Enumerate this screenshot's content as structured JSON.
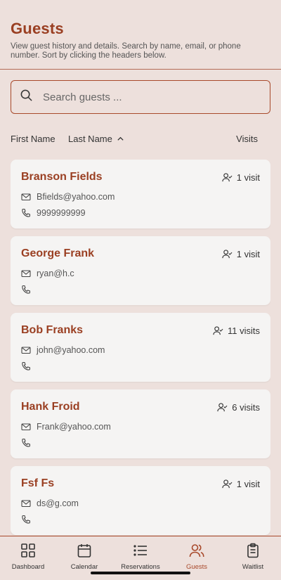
{
  "header": {
    "title": "Guests",
    "subtitle": "View guest history and details. Search by name, email, or phone number. Sort by clicking the headers below."
  },
  "search": {
    "placeholder": "Search guests ..."
  },
  "columns": {
    "first": "First Name",
    "last": "Last Name",
    "visits": "Visits"
  },
  "guests": [
    {
      "name": "Branson Fields",
      "visits": "1 visit",
      "email": "Bfields@yahoo.com",
      "phone": "9999999999"
    },
    {
      "name": "George Frank",
      "visits": "1 visit",
      "email": "ryan@h.c",
      "phone": ""
    },
    {
      "name": "Bob Franks",
      "visits": "11 visits",
      "email": "john@yahoo.com",
      "phone": ""
    },
    {
      "name": "Hank Froid",
      "visits": "6 visits",
      "email": "Frank@yahoo.com",
      "phone": ""
    },
    {
      "name": "Fsf Fs",
      "visits": "1 visit",
      "email": "ds@g.com",
      "phone": ""
    }
  ],
  "tabs": [
    {
      "label": "Dashboard",
      "icon": "grid-icon"
    },
    {
      "label": "Calendar",
      "icon": "calendar-icon"
    },
    {
      "label": "Reservations",
      "icon": "list-icon"
    },
    {
      "label": "Guests",
      "icon": "users-icon",
      "active": true
    },
    {
      "label": "Waitlist",
      "icon": "clipboard-icon"
    }
  ],
  "colors": {
    "accent": "#a8492b",
    "title": "#9a3f22",
    "background": "#ede0dc",
    "card": "#f5f4f3"
  }
}
